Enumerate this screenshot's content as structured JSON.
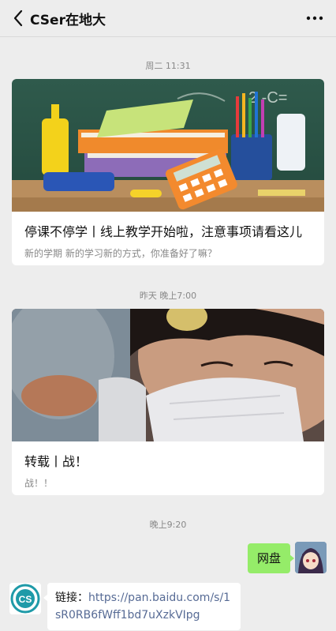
{
  "header": {
    "title": "CSer在地大"
  },
  "timestamps": {
    "t1": "周二 11:31",
    "t2": "昨天 晚上7:00",
    "t3": "晚上9:20"
  },
  "articles": [
    {
      "title": "停课不停学丨线上教学开始啦，注意事项请看这儿",
      "description": "新的学期 新的学习新的方式，你准备好了嘛？"
    },
    {
      "title": "转载丨战！",
      "description": "战！！"
    }
  ],
  "messages": {
    "outgoing_text": "网盘",
    "incoming_prefix": "链接：",
    "incoming_link": "https://pan.baidu.com/s/1sR0RB6fWff1bd7uXzkVIpg"
  },
  "colors": {
    "background": "#ededed",
    "outgoing_bubble": "#95ec69",
    "link": "#576b95",
    "logo_teal": "#1e9aa8"
  },
  "icons": {
    "back": "chevron-left-icon",
    "more": "ellipsis-icon"
  }
}
